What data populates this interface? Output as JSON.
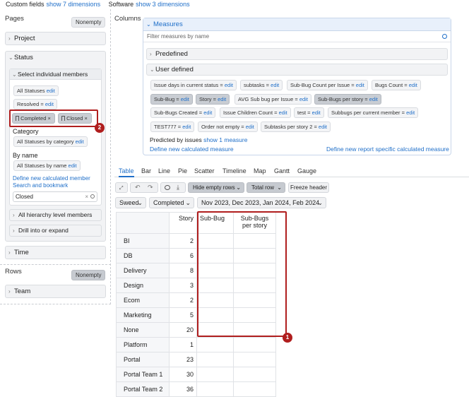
{
  "topbar": {
    "custom_fields_label": "Custom fields",
    "custom_fields_link": "show 7 dimensions",
    "software_label": "Software",
    "software_link": "show 3 dimensions"
  },
  "pages": {
    "label": "Pages",
    "nonempty": "Nonempty",
    "project": "Project",
    "status": "Status",
    "select_members": "Select individual members",
    "all_statuses": "All Statuses",
    "resolved": "Resolved =",
    "edit": "edit",
    "chips": [
      "Completed",
      "Closed"
    ],
    "category_label": "Category",
    "all_statuses_by_category": "All Statuses by category",
    "by_name_label": "By name",
    "all_statuses_by_name": "All Statuses by name",
    "define_member": "Define new calculated member",
    "search_bookmark": "Search and bookmark",
    "search_value": "Closed",
    "all_hierarchy": "All hierarchy level members",
    "drill_into": "Drill into or expand",
    "time": "Time"
  },
  "rows": {
    "label": "Rows",
    "nonempty": "Nonempty",
    "team": "Team"
  },
  "columns": {
    "label": "Columns",
    "measures_title": "Measures",
    "filter_placeholder": "Filter measures by name",
    "predefined": "Predefined",
    "user_defined": "User defined",
    "measures": [
      "Issue days in current status =",
      "subtasks =",
      "Sub-Bug Count per Issue =",
      "Bugs Count =",
      "Sub-Bug =",
      "Story =",
      "AVG Sub bug per Issue =",
      "Sub-Bugs per story =",
      "Sub-Bugs Created =",
      "Issue Children Count =",
      "test =",
      "Subbugs per current member =",
      "TEST777 =",
      "Order not empty =",
      "Subtasks per story 2 ="
    ],
    "predicted_label": "Predicted by issues",
    "predicted_link": "show 1 measure",
    "define_calc": "Define new calculated measure",
    "define_report": "Define new report specific calculated measure"
  },
  "tabs": [
    "Table",
    "Bar",
    "Line",
    "Pie",
    "Scatter",
    "Timeline",
    "Map",
    "Gantt",
    "Gauge"
  ],
  "toolbar": {
    "hide_empty_rows": "Hide empty rows",
    "total_row": "Total row",
    "freeze_header": "Freeze header"
  },
  "filters": {
    "sweed": "Sweed",
    "completed": "Completed",
    "time_range": "Nov 2023, Dec 2023, Jan 2024, Feb 2024"
  },
  "table": {
    "headers": [
      "Story",
      "Sub-Bug",
      "Sub-Bugs per story"
    ],
    "rows": [
      {
        "name": "BI",
        "story": "2"
      },
      {
        "name": "DB",
        "story": "6"
      },
      {
        "name": "Delivery",
        "story": "8"
      },
      {
        "name": "Design",
        "story": "3"
      },
      {
        "name": "Ecom",
        "story": "2"
      },
      {
        "name": "Marketing",
        "story": "5"
      },
      {
        "name": "None",
        "story": "20"
      },
      {
        "name": "Platform",
        "story": "1"
      },
      {
        "name": "Portal",
        "story": "23"
      },
      {
        "name": "Portal Team 1",
        "story": "30"
      },
      {
        "name": "Portal Team 2",
        "story": "36"
      }
    ]
  },
  "markers": [
    "1",
    "2"
  ],
  "colors": {
    "accent": "#1f6fc9",
    "annotation": "#b01e1e"
  }
}
